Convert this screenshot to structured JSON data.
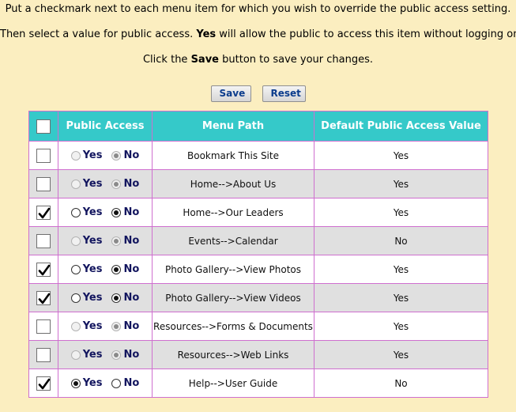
{
  "instructions": {
    "line1": "Put a checkmark next to each menu item for which you wish to override the public access setting.",
    "line2_a": "Then select a value for public access. ",
    "line2_bold": "Yes",
    "line2_b": " will allow the public to access this item without logging on.",
    "line3_a": "Click the ",
    "line3_bold": "Save",
    "line3_b": " button to save your changes."
  },
  "buttons": {
    "save_label": "Save",
    "reset_label": "Reset"
  },
  "table": {
    "headers": {
      "public_access": "Public Access",
      "menu_path": "Menu Path",
      "default_value": "Default Public Access Value"
    },
    "yes_label": "Yes",
    "no_label": "No",
    "rows": [
      {
        "checked": false,
        "selected": "no",
        "path": "Bookmark This Site",
        "default": "Yes"
      },
      {
        "checked": false,
        "selected": "no",
        "path": "Home-->About Us",
        "default": "Yes"
      },
      {
        "checked": true,
        "selected": "no",
        "path": "Home-->Our Leaders",
        "default": "Yes"
      },
      {
        "checked": false,
        "selected": "no",
        "path": "Events-->Calendar",
        "default": "No"
      },
      {
        "checked": true,
        "selected": "no",
        "path": "Photo Gallery-->View Photos",
        "default": "Yes"
      },
      {
        "checked": true,
        "selected": "no",
        "path": "Photo Gallery-->View Videos",
        "default": "Yes"
      },
      {
        "checked": false,
        "selected": "no",
        "path": "Resources-->Forms & Documents",
        "default": "Yes"
      },
      {
        "checked": false,
        "selected": "no",
        "path": "Resources-->Web Links",
        "default": "Yes"
      },
      {
        "checked": true,
        "selected": "yes",
        "path": "Help-->User Guide",
        "default": "No"
      }
    ]
  },
  "colors": {
    "page_bg": "#fbeec0",
    "header_bg": "#35c9c9",
    "border": "#cf6fcf",
    "alt_row": "#e0e0e0",
    "label_text": "#12155e",
    "button_text": "#0b3c8c"
  }
}
